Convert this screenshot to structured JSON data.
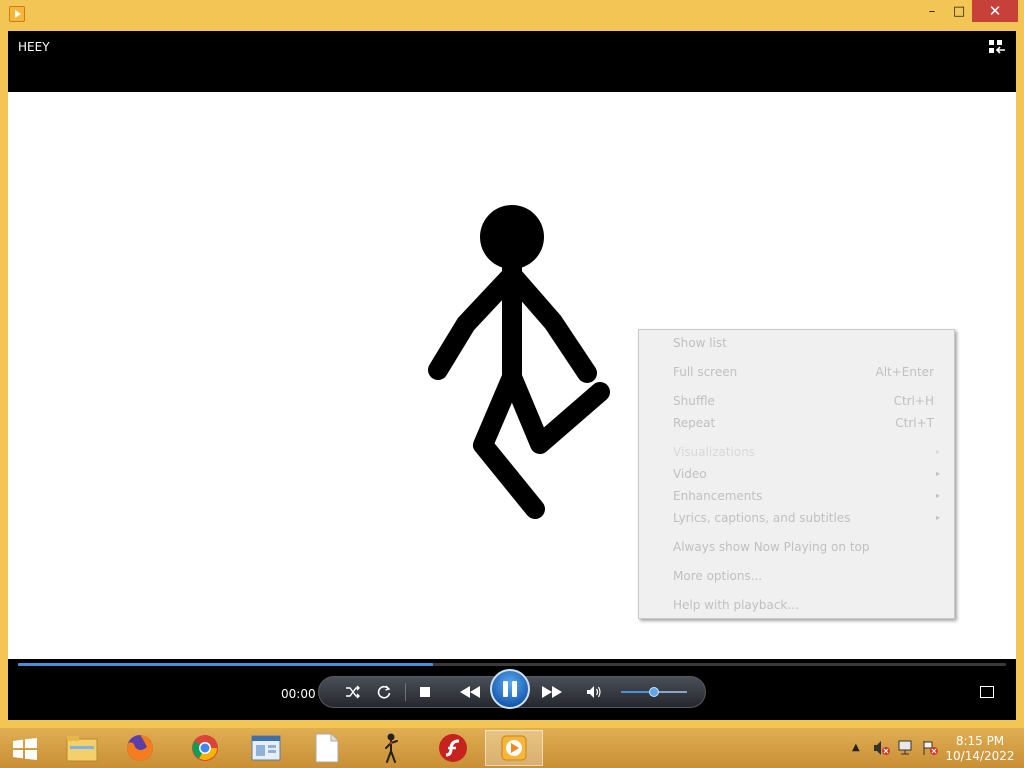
{
  "window": {
    "title": "",
    "controls": {
      "minimize": "–",
      "maximize": "□",
      "close": "✕"
    }
  },
  "player": {
    "video_title": "HEEY",
    "time": "00:00",
    "seek_progress_percent": 42,
    "volume_percent": 50
  },
  "context_menu": {
    "items": [
      {
        "label": "Show list",
        "shortcut": ""
      },
      {
        "label": "Full screen",
        "shortcut": "Alt+Enter"
      },
      {
        "label": "Shuffle",
        "shortcut": "Ctrl+H"
      },
      {
        "label": "Repeat",
        "shortcut": "Ctrl+T"
      },
      {
        "label": "Visualizations",
        "submenu": "▸"
      },
      {
        "label": "Video",
        "submenu": "▸"
      },
      {
        "label": "Enhancements",
        "submenu": "▸"
      },
      {
        "label": "Lyrics, captions, and subtitles",
        "submenu": "▸"
      },
      {
        "label": "Always show Now Playing on top",
        "shortcut": ""
      },
      {
        "label": "More options...",
        "shortcut": ""
      },
      {
        "label": "Help with playback...",
        "shortcut": ""
      }
    ]
  },
  "taskbar": {
    "apps": [
      {
        "name": "file-explorer-icon"
      },
      {
        "name": "firefox-icon"
      },
      {
        "name": "chrome-icon"
      },
      {
        "name": "control-panel-icon"
      },
      {
        "name": "notepad-icon"
      },
      {
        "name": "pivot-animator-icon"
      },
      {
        "name": "flash-player-icon"
      },
      {
        "name": "media-player-icon",
        "active": true
      }
    ],
    "clock_time": "8:15 PM",
    "clock_date": "10/14/2022"
  },
  "colors": {
    "window_frame": "#f2c554",
    "taskbar": "#d8a44a",
    "accent": "#4b8fd6",
    "close": "#c7413a"
  }
}
